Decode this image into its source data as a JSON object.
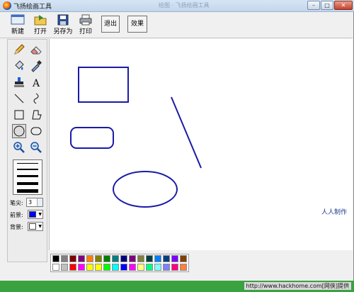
{
  "window": {
    "title": "飞扬绘画工具",
    "ghost_title": "绘图 · 飞扬绘画工具"
  },
  "window_controls": {
    "minimize": "–",
    "maximize": "□",
    "close": "✕"
  },
  "toolbar": {
    "new_label": "新建",
    "open_label": "打开",
    "saveas_label": "另存为",
    "print_label": "打印",
    "exit_label": "退出",
    "effect_label": "效果"
  },
  "tools": [
    {
      "name": "pencil-icon"
    },
    {
      "name": "eraser-icon"
    },
    {
      "name": "fill-bucket-icon"
    },
    {
      "name": "eyedropper-icon"
    },
    {
      "name": "stamp-icon"
    },
    {
      "name": "text-tool-icon",
      "glyph": "A"
    },
    {
      "name": "line-icon"
    },
    {
      "name": "curve-icon"
    },
    {
      "name": "rectangle-icon"
    },
    {
      "name": "polygon-icon"
    },
    {
      "name": "ellipse-icon",
      "active": true
    },
    {
      "name": "rounded-rect-icon"
    },
    {
      "name": "zoom-in-icon"
    },
    {
      "name": "zoom-out-icon"
    }
  ],
  "options": {
    "pen_label": "笔尖:",
    "pen_size": "3",
    "fore_label": "前景:",
    "back_label": "背景:",
    "fore_color": "#0000ff",
    "back_color": "#ffffff"
  },
  "canvas": {
    "credit": "人人制作",
    "stroke_color": "#1a1aa8"
  },
  "palette": {
    "row1": [
      "#000000",
      "#808080",
      "#800000",
      "#800080",
      "#ff8000",
      "#808000",
      "#008000",
      "#008080",
      "#000080",
      "#800080",
      "#808040",
      "#004040",
      "#0080ff",
      "#004080",
      "#8000ff",
      "#804000"
    ],
    "row2": [
      "#ffffff",
      "#c0c0c0",
      "#ff0000",
      "#ff00ff",
      "#ffff00",
      "#ffff00",
      "#00ff00",
      "#00ffff",
      "#0000ff",
      "#ff00ff",
      "#ffff80",
      "#00ff80",
      "#80ffff",
      "#8080ff",
      "#ff0080",
      "#ff8040"
    ]
  },
  "watermark": "http://www.hackhome.com[网侠]提供"
}
